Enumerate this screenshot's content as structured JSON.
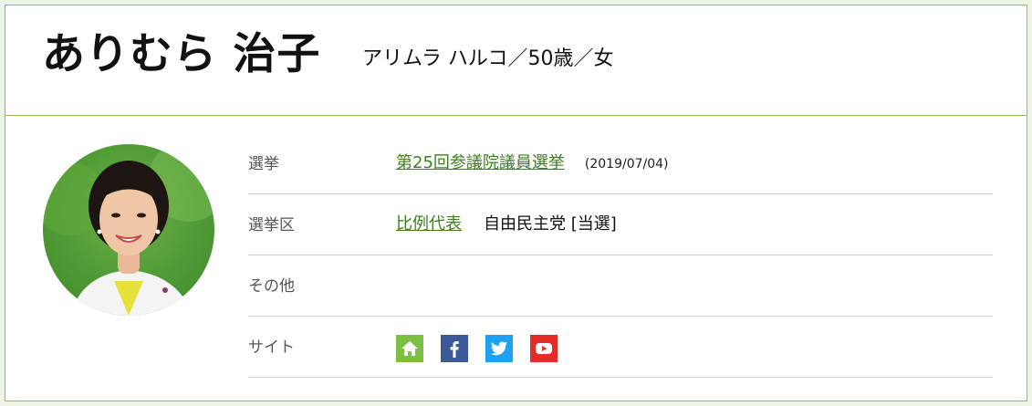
{
  "profile": {
    "name": "ありむら 治子",
    "kana_age_gender": "アリムラ ハルコ／50歳／女"
  },
  "rows": {
    "election": {
      "label": "選挙",
      "link": "第25回参議院議員選挙",
      "date": "(2019/07/04)"
    },
    "district": {
      "label": "選挙区",
      "link": "比例代表",
      "party_result": "自由民主党 [当選]"
    },
    "other": {
      "label": "その他"
    },
    "site": {
      "label": "サイト",
      "icons": [
        "home-icon",
        "facebook-icon",
        "twitter-icon",
        "youtube-icon"
      ]
    }
  },
  "colors": {
    "accent_border": "#8cc255",
    "link": "#3f7f1f",
    "home": "#7dbf43",
    "facebook": "#3b5998",
    "twitter": "#1da1f2",
    "youtube": "#e52d27"
  }
}
